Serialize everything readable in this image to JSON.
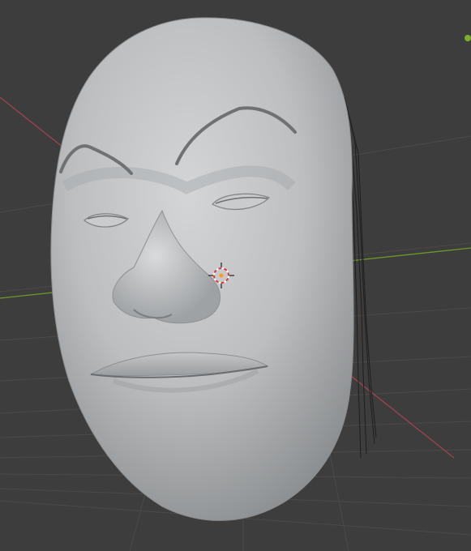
{
  "viewport": {
    "background_color": "#3d3d3d",
    "grid_line_color": "#4a4a4a",
    "x_axis_color": "#a04451",
    "y_axis_color": "#6b9a2a",
    "selection_outline_color": "#1e1e1e"
  },
  "mesh": {
    "surface_color": "#b4b6b8",
    "highlight_color": "#d3d5d7",
    "shadow_color": "#8c8f91",
    "stroke_color": "#5a5c5e"
  },
  "icons": {
    "cursor": "3d-cursor-icon",
    "origin": "object-origin-icon"
  },
  "colors": {
    "origin_dot": "#7fae2e",
    "cursor_ring_red": "#d04040",
    "cursor_ring_white": "#ffffff",
    "cursor_center": "#ff9a1c"
  }
}
